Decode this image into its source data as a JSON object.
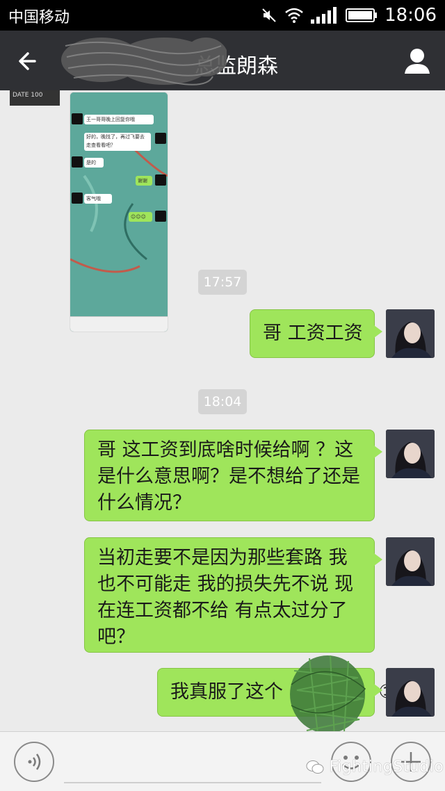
{
  "status_bar": {
    "carrier": "中国移动",
    "time": "18:06",
    "icons": [
      "mute-icon",
      "wifi-icon",
      "signal-icon",
      "battery-icon"
    ]
  },
  "header": {
    "title": "总监朗森",
    "back_icon": "back-arrow-icon",
    "profile_icon": "person-icon"
  },
  "screenshot_msg": {
    "thumb_text": "DATE 100",
    "lines": [
      "王一哥哥晚上回复你哦",
      "好的，晚找了，再过飞要去走查看看吧？",
      "是的",
      "谢谢",
      "客气哦",
      "☺☺☺"
    ]
  },
  "timestamps": [
    "17:57",
    "18:04"
  ],
  "messages": [
    {
      "text": "哥  工资工资"
    },
    {
      "text": "哥  这工资到底啥时候给啊 ？这是什么意思啊？是不想给了还是什么情况？"
    },
    {
      "text": "当初走要不是因为那些套路 我也不可能走   我的损失先不说   现在连工资都不给  有点太过分了吧？"
    },
    {
      "text": "我真服了这个                ①"
    }
  ],
  "input_bar": {
    "voice_icon": "voice-icon",
    "emoji_icon": "emoji-icon",
    "plus_icon": "plus-icon",
    "watermark": "FightingStudio",
    "watermark_icon": "wechat-icon"
  },
  "colors": {
    "sent_bubble": "#9fe55b",
    "chat_bg": "#ebebeb",
    "title_bar": "#2f3034",
    "timestamp_chip": "#d4d4d4"
  }
}
